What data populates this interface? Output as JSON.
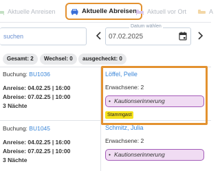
{
  "tabs": [
    {
      "label": "Aktuelle Anreisen",
      "active": false
    },
    {
      "label": "Aktuelle Abreisen",
      "active": true
    },
    {
      "label": "Aktuell vor Ort",
      "active": false
    }
  ],
  "search": {
    "placeholder": "suchen"
  },
  "date_filter": {
    "legend": "Datum wählen",
    "value": "07.02.2025"
  },
  "chips": [
    "Gesamt: 2",
    "Wechsel: 0",
    "ausgecheckt: 0"
  ],
  "bookings": [
    {
      "booking_label": "Buchung:",
      "booking_id": "BU1036",
      "arrival": "Anreise: 04.02.25 | 16:00",
      "departure": "Abreise: 07.02.25 | 10:00",
      "nights": "3 Nächte",
      "guest": "Löffel, Pelle",
      "adults": "Erwachsene: 2",
      "note": "Kautionserinnerung",
      "badge": "Stammgast"
    },
    {
      "booking_label": "Buchung:",
      "booking_id": "BU1045",
      "arrival": "Anreise: 04.02.25 | 16:00",
      "departure": "Abreise: 07.02.25 | 10:00",
      "nights": "3 Nächte",
      "guest": "Schmitz, Julia",
      "adults": "Erwachsene: 2",
      "note": "Kautionserinnerung"
    }
  ],
  "colors": {
    "highlight": "#e3912f",
    "link": "#3a86d8",
    "note_bg": "#f0dcf3",
    "note_border": "#a35ab8",
    "badge_bg": "#f5e11b"
  }
}
